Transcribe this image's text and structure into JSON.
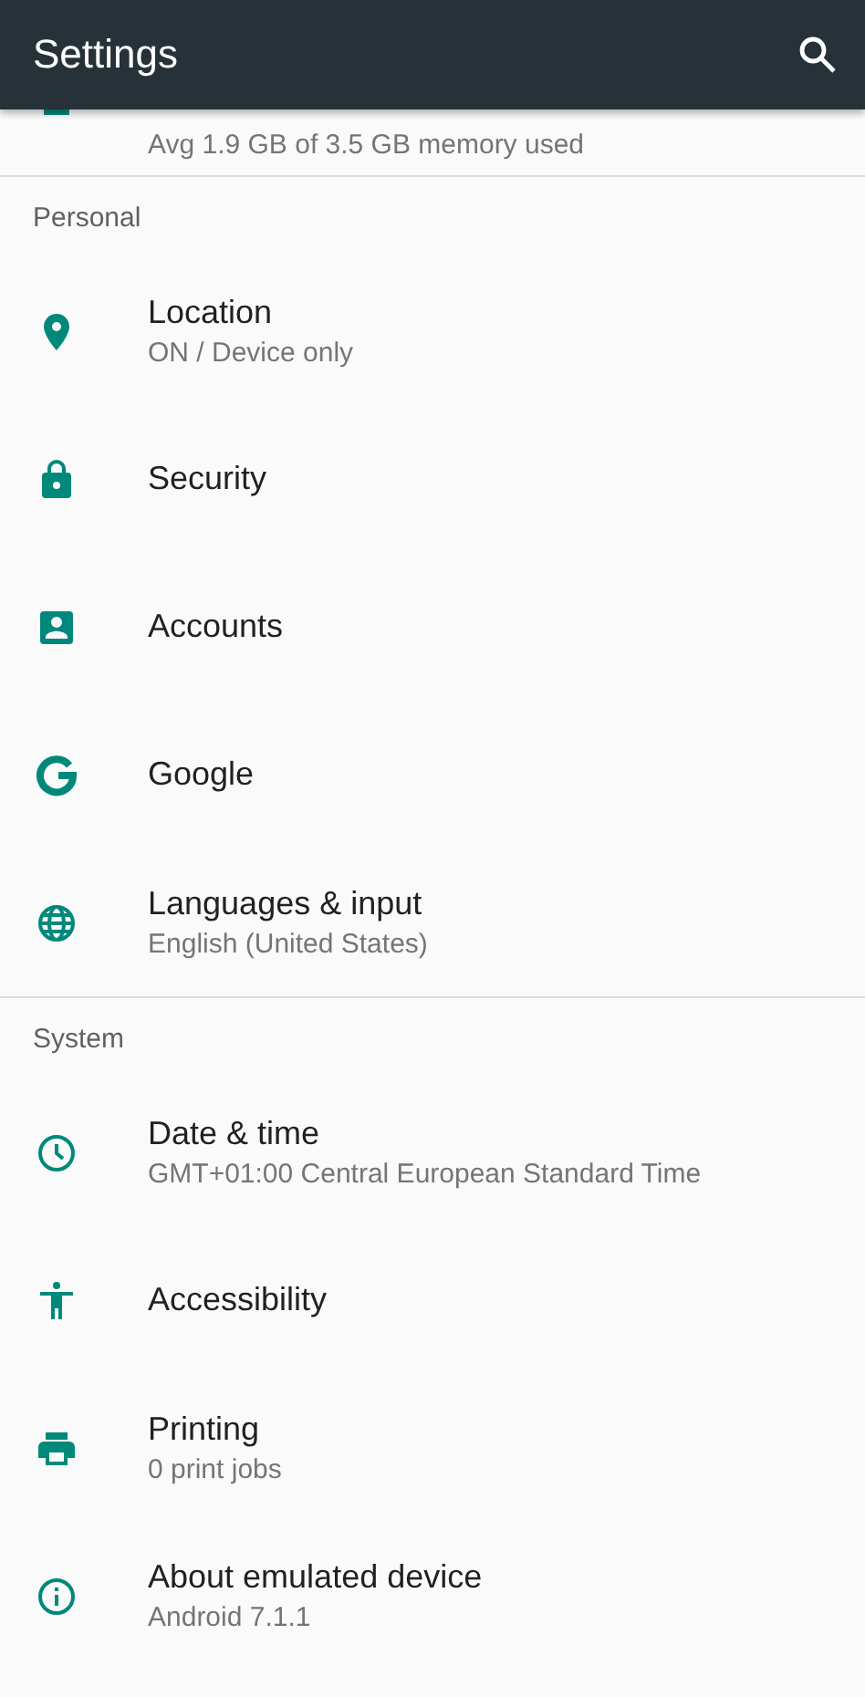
{
  "app_bar": {
    "title": "Settings"
  },
  "sections": [
    {
      "items": [
        {
          "summary": "Avg 1.9 GB of 3.5 GB memory used"
        }
      ]
    },
    {
      "header": "Personal",
      "items": [
        {
          "title": "Location",
          "summary": "ON / Device only"
        },
        {
          "title": "Security"
        },
        {
          "title": "Accounts"
        },
        {
          "title": "Google"
        },
        {
          "title": "Languages & input",
          "summary": "English (United States)"
        }
      ]
    },
    {
      "header": "System",
      "items": [
        {
          "title": "Date & time",
          "summary": "GMT+01:00 Central European Standard Time"
        },
        {
          "title": "Accessibility"
        },
        {
          "title": "Printing",
          "summary": "0 print jobs"
        },
        {
          "title": "About emulated device",
          "summary": "Android 7.1.1"
        }
      ]
    }
  ]
}
